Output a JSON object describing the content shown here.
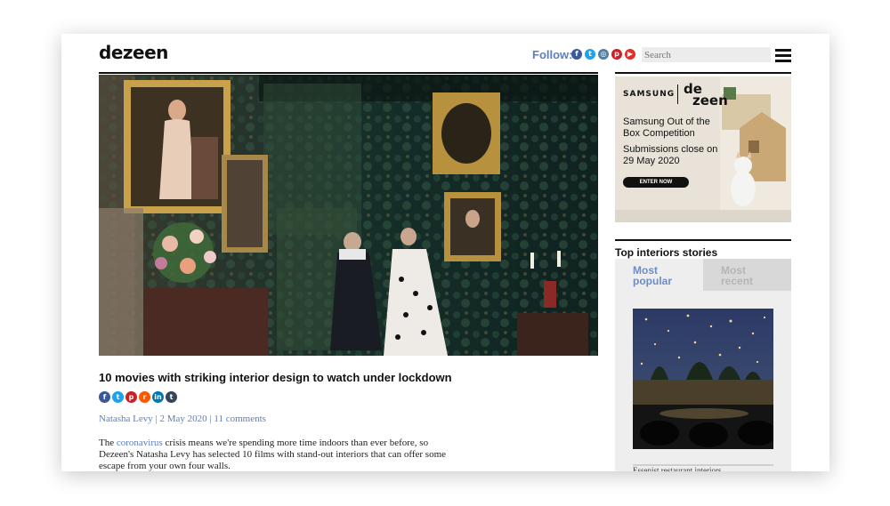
{
  "header": {
    "logo": "dezeen",
    "follow_label": "Follow:",
    "social_icons": [
      {
        "name": "facebook-icon",
        "glyph": "f",
        "color": "#3b5998"
      },
      {
        "name": "twitter-icon",
        "glyph": "t",
        "color": "#1da1f2"
      },
      {
        "name": "instagram-icon",
        "glyph": "◎",
        "color": "#517fa4"
      },
      {
        "name": "pinterest-icon",
        "glyph": "p",
        "color": "#cb2027"
      },
      {
        "name": "youtube-icon",
        "glyph": "▶",
        "color": "#e52d27"
      }
    ],
    "search_placeholder": "Search"
  },
  "article": {
    "title": "10 movies with striking interior design to watch under lockdown",
    "share_icons": [
      {
        "name": "share-facebook-icon",
        "glyph": "f",
        "color": "#3b5998"
      },
      {
        "name": "share-twitter-icon",
        "glyph": "t",
        "color": "#1da1f2"
      },
      {
        "name": "share-pinterest-icon",
        "glyph": "p",
        "color": "#cb2027"
      },
      {
        "name": "share-reddit-icon",
        "glyph": "r",
        "color": "#ff5700"
      },
      {
        "name": "share-linkedin-icon",
        "glyph": "in",
        "color": "#0077b5"
      },
      {
        "name": "share-tumblr-icon",
        "glyph": "t",
        "color": "#35465c"
      }
    ],
    "author": "Natasha Levy",
    "date": "2 May 2020",
    "comments": "11 comments",
    "separator": "|",
    "body_pre": "The ",
    "body_link": "coronavirus",
    "body_post": " crisis means we're spending more time indoors than ever before, so Dezeen's Natasha Levy has selected 10 films with stand-out interiors that can offer some escape from your own four walls."
  },
  "ad": {
    "brand_left": "SAMSUNG",
    "brand_right_top": "de",
    "brand_right_bottom": "zeen",
    "headline": "Samsung Out of the Box Competition",
    "subline": "Submissions close on 29 May 2020",
    "cta": "ENTER NOW"
  },
  "sidebar": {
    "section_title": "Top interiors stories",
    "tabs": [
      {
        "label_line1": "Most",
        "label_line2": "popular",
        "active": true
      },
      {
        "label_line1": "Most",
        "label_line2": "recent",
        "active": false
      }
    ],
    "next_item_text": "Essenist restaurant interiors"
  },
  "colors": {
    "link_blue": "#5b7fc2",
    "tab_active_text": "#6f8cc4",
    "tab_inactive_text": "#b5b5b5"
  }
}
